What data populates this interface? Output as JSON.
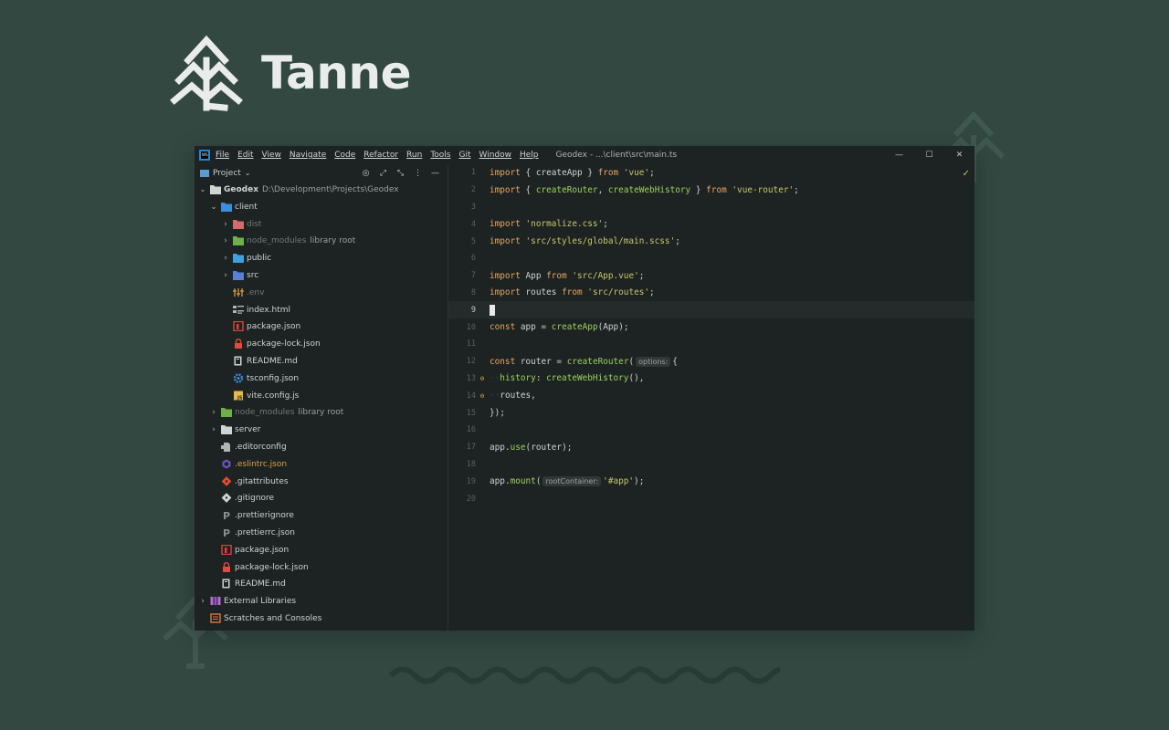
{
  "brand": {
    "name": "Tanne"
  },
  "window": {
    "menu": [
      "File",
      "Edit",
      "View",
      "Navigate",
      "Code",
      "Refactor",
      "Run",
      "Tools",
      "Git",
      "Window",
      "Help"
    ],
    "title": "Geodex - ...\\client\\src\\main.ts",
    "controls": {
      "minimize": "—",
      "maximize": "☐",
      "close": "✕"
    }
  },
  "project_panel": {
    "title": "Project",
    "tools": [
      "◎",
      "⤢",
      "⤡",
      "⋮",
      "—"
    ],
    "tree": [
      {
        "label": "Geodex",
        "extra": "D:\\Development\\Projects\\Geodex",
        "icon": "folder-icon",
        "chevron": "⌄",
        "style": "bold"
      },
      {
        "label": "client",
        "icon": "module-folder-icon",
        "chevron": "⌄",
        "style": ""
      },
      {
        "label": "dist",
        "icon": "excluded-folder-icon",
        "chevron": "›",
        "style": "dim"
      },
      {
        "label": "node_modules",
        "extra": "library root",
        "icon": "library-folder-icon",
        "chevron": "›",
        "style": "dim"
      },
      {
        "label": "public",
        "icon": "resource-folder-icon",
        "chevron": "›",
        "style": ""
      },
      {
        "label": "src",
        "icon": "source-folder-icon",
        "chevron": "›",
        "style": ""
      },
      {
        "label": ".env",
        "icon": "env-file-icon",
        "chevron": "",
        "style": "dim"
      },
      {
        "label": "index.html",
        "icon": "html-file-icon",
        "chevron": "",
        "style": ""
      },
      {
        "label": "package.json",
        "icon": "npm-file-icon",
        "chevron": "",
        "style": ""
      },
      {
        "label": "package-lock.json",
        "icon": "lock-file-icon",
        "chevron": "",
        "style": ""
      },
      {
        "label": "README.md",
        "icon": "markdown-file-icon",
        "chevron": "",
        "style": ""
      },
      {
        "label": "tsconfig.json",
        "icon": "tsconfig-file-icon",
        "chevron": "",
        "style": ""
      },
      {
        "label": "vite.config.js",
        "icon": "js-file-icon",
        "chevron": "",
        "style": ""
      },
      {
        "label": "node_modules",
        "extra": "library root",
        "icon": "library-folder-icon",
        "chevron": "›",
        "style": "dim"
      },
      {
        "label": "server",
        "icon": "folder-icon",
        "chevron": "›",
        "style": ""
      },
      {
        "label": ".editorconfig",
        "icon": "editorconfig-file-icon",
        "chevron": "",
        "style": ""
      },
      {
        "label": ".eslintrc.json",
        "icon": "eslint-file-icon",
        "chevron": "",
        "style": "orange"
      },
      {
        "label": ".gitattributes",
        "icon": "git-file-icon",
        "chevron": "",
        "style": ""
      },
      {
        "label": ".gitignore",
        "icon": "gitignore-file-icon",
        "chevron": "",
        "style": ""
      },
      {
        "label": ".prettierignore",
        "icon": "prettier-file-icon",
        "chevron": "",
        "style": ""
      },
      {
        "label": ".prettierrc.json",
        "icon": "prettier-file-icon",
        "chevron": "",
        "style": ""
      },
      {
        "label": "package.json",
        "icon": "npm-file-icon",
        "chevron": "",
        "style": ""
      },
      {
        "label": "package-lock.json",
        "icon": "lock-file-icon",
        "chevron": "",
        "style": ""
      },
      {
        "label": "README.md",
        "icon": "markdown-file-icon",
        "chevron": "",
        "style": ""
      },
      {
        "label": "External Libraries",
        "icon": "libraries-icon",
        "chevron": "›",
        "style": ""
      },
      {
        "label": "Scratches and Consoles",
        "icon": "scratches-icon",
        "chevron": "",
        "style": ""
      }
    ]
  },
  "editor": {
    "current_line": 9,
    "inspection_status": "✓",
    "gutter_icon": "ɵ",
    "hints": {
      "options": "options:",
      "root_container": "rootContainer:"
    },
    "lines": [
      {
        "n": 1,
        "t": "import { createApp } from 'vue';"
      },
      {
        "n": 2,
        "t": "import { createRouter, createWebHistory } from 'vue-router';"
      },
      {
        "n": 3,
        "t": ""
      },
      {
        "n": 4,
        "t": "import 'normalize.css';"
      },
      {
        "n": 5,
        "t": "import 'src/styles/global/main.scss';"
      },
      {
        "n": 6,
        "t": ""
      },
      {
        "n": 7,
        "t": "import App from 'src/App.vue';"
      },
      {
        "n": 8,
        "t": "import routes from 'src/routes';"
      },
      {
        "n": 9,
        "t": ""
      },
      {
        "n": 10,
        "t": "const app = createApp(App);"
      },
      {
        "n": 11,
        "t": ""
      },
      {
        "n": 12,
        "t": "const router = createRouter({"
      },
      {
        "n": 13,
        "t": "  history: createWebHistory(),"
      },
      {
        "n": 14,
        "t": "  routes,"
      },
      {
        "n": 15,
        "t": "});"
      },
      {
        "n": 16,
        "t": ""
      },
      {
        "n": 17,
        "t": "app.use(router);"
      },
      {
        "n": 18,
        "t": ""
      },
      {
        "n": 19,
        "t": "app.mount('#app');"
      },
      {
        "n": 20,
        "t": ""
      }
    ]
  }
}
